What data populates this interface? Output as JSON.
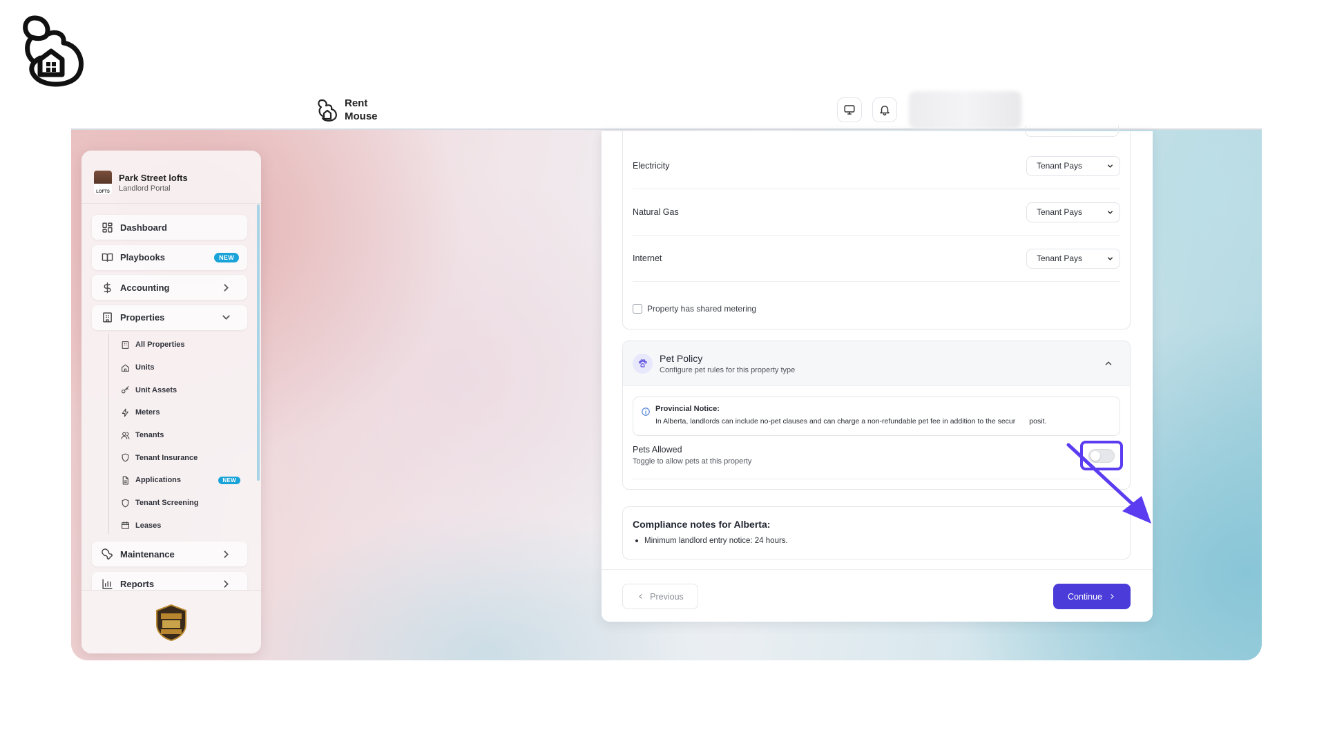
{
  "app": {
    "brand_name": "Rent Mouse"
  },
  "sidebar": {
    "org_name": "Park Street lofts",
    "org_sub": "Landlord Portal",
    "items": [
      {
        "label": "Dashboard",
        "icon": "dashboard-icon"
      },
      {
        "label": "Playbooks",
        "icon": "book-icon",
        "badge": "NEW"
      },
      {
        "label": "Accounting",
        "icon": "dollar-icon"
      },
      {
        "label": "Properties",
        "icon": "building-icon"
      },
      {
        "label": "Maintenance",
        "icon": "wrench-icon"
      },
      {
        "label": "Reports",
        "icon": "bar-chart-icon"
      }
    ],
    "sub_items": [
      {
        "label": "All Properties",
        "icon": "building-icon"
      },
      {
        "label": "Units",
        "icon": "home-icon"
      },
      {
        "label": "Unit Assets",
        "icon": "key-icon"
      },
      {
        "label": "Meters",
        "icon": "lightning-icon"
      },
      {
        "label": "Tenants",
        "icon": "users-icon"
      },
      {
        "label": "Tenant Insurance",
        "icon": "shield-icon"
      },
      {
        "label": "Applications",
        "icon": "document-icon",
        "badge": "NEW"
      },
      {
        "label": "Tenant Screening",
        "icon": "shield-icon"
      },
      {
        "label": "Leases",
        "icon": "calendar-icon"
      }
    ]
  },
  "utilities": [
    {
      "label": "Electricity",
      "value": "Tenant Pays"
    },
    {
      "label": "Natural Gas",
      "value": "Tenant Pays"
    },
    {
      "label": "Internet",
      "value": "Tenant Pays"
    }
  ],
  "shared_metering_label": "Property has shared metering",
  "pet_policy": {
    "title": "Pet Policy",
    "subtitle": "Configure pet rules for this property type",
    "notice_title": "Provincial Notice:",
    "notice_text": "In Alberta, landlords can include no-pet clauses and can charge a non-refundable pet fee in addition to the secur",
    "notice_text_tail": "posit.",
    "toggle_label": "Pets Allowed",
    "toggle_sub": "Toggle to allow pets at this property",
    "pets_allowed": false
  },
  "compliance": {
    "title": "Compliance notes for Alberta:",
    "notes": [
      "Minimum landlord entry notice: 24 hours."
    ]
  },
  "buttons": {
    "previous": "Previous",
    "continue": "Continue"
  },
  "colors": {
    "accent": "#4b3bd8",
    "highlight": "#5b3cf0",
    "badge": "#1aa3d9"
  }
}
